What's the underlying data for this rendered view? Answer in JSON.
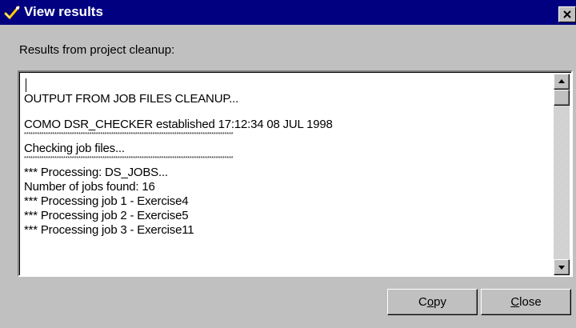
{
  "window": {
    "title": "View results",
    "title_icon": "check-wand-icon",
    "close_icon": "close-icon"
  },
  "dialog": {
    "prompt": "Results from project cleanup:"
  },
  "results": {
    "lines": [
      "OUTPUT FROM JOB FILES CLEANUP...",
      "COMO DSR_CHECKER established 17:12:34 08 JUL 1998",
      "************************************************************************************************",
      "Checking job files...",
      "************************************************************************************************",
      "*** Processing: DS_JOBS...",
      "Number of jobs found: 16",
      "*** Processing job 1 - Exercise4",
      "*** Processing job 2 - Exercise5",
      "*** Processing job 3 - Exercise11"
    ]
  },
  "buttons": {
    "copy": {
      "pre": "C",
      "mnemonic": "o",
      "post": "py"
    },
    "close": {
      "pre": "",
      "mnemonic": "C",
      "post": "lose"
    }
  },
  "colors": {
    "titlebar": "#000080",
    "face": "#c0c0c0",
    "text_area": "#ffffff"
  }
}
